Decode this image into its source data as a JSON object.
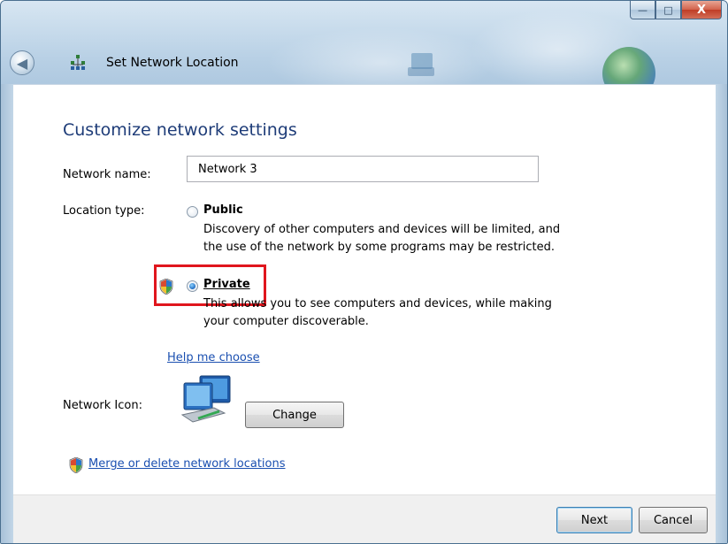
{
  "window": {
    "title": "Set Network Location",
    "caption": {
      "minimize": "—",
      "maximize": "□",
      "close": "X"
    },
    "back_glyph": "◀"
  },
  "page": {
    "heading": "Customize network settings",
    "network_name": {
      "label": "Network name:",
      "value": "Network 3"
    },
    "location_type": {
      "label": "Location type:",
      "options": [
        {
          "title": "Public",
          "selected": false,
          "description_line1": "Discovery of other computers and devices will be limited, and",
          "description_line2": "the use of the network by some programs may be restricted."
        },
        {
          "title": "Private",
          "selected": true,
          "description_line1": "This allows you to see computers and devices, while making",
          "description_line2": "your computer discoverable."
        }
      ]
    },
    "help_link": "Help me choose",
    "network_icon": {
      "label": "Network Icon:",
      "change_button": "Change"
    },
    "merge_link": "Merge or delete network locations"
  },
  "footer": {
    "next_button": "Next",
    "cancel_button": "Cancel"
  },
  "colors": {
    "heading": "#1e3c78",
    "link": "#1a4fb0",
    "highlight": "#e0161d"
  }
}
